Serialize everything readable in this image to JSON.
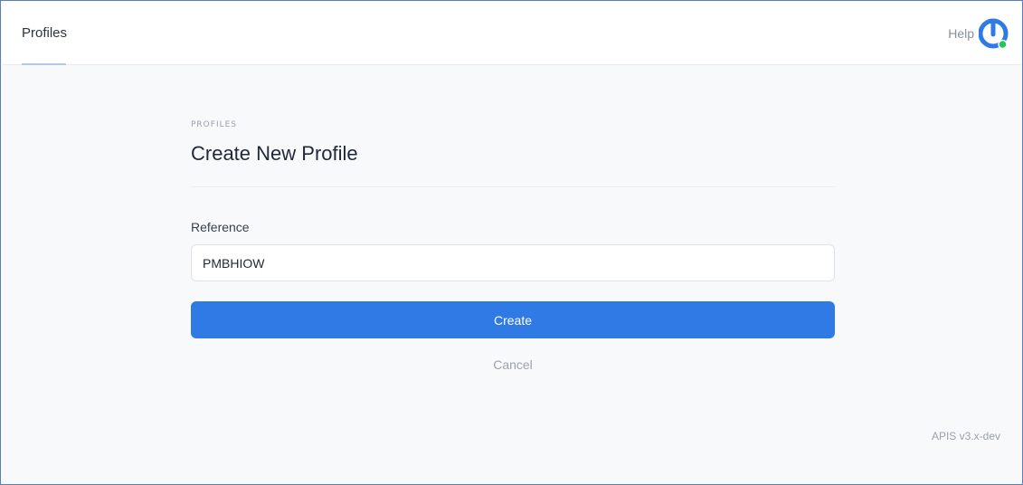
{
  "topbar": {
    "nav_tab": "Profiles",
    "help_label": "Help",
    "logo_icon": "power-logo-icon",
    "logo_color": "#2f7ae5",
    "status_dot_color": "#22c55e"
  },
  "page": {
    "section_label": "PROFILES",
    "title": "Create New Profile"
  },
  "form": {
    "reference_label": "Reference",
    "reference_value": "PMBHIOW",
    "create_label": "Create",
    "cancel_label": "Cancel",
    "accent_color": "#2f7ae5"
  },
  "footer": {
    "version": "APIS v3.x-dev"
  }
}
